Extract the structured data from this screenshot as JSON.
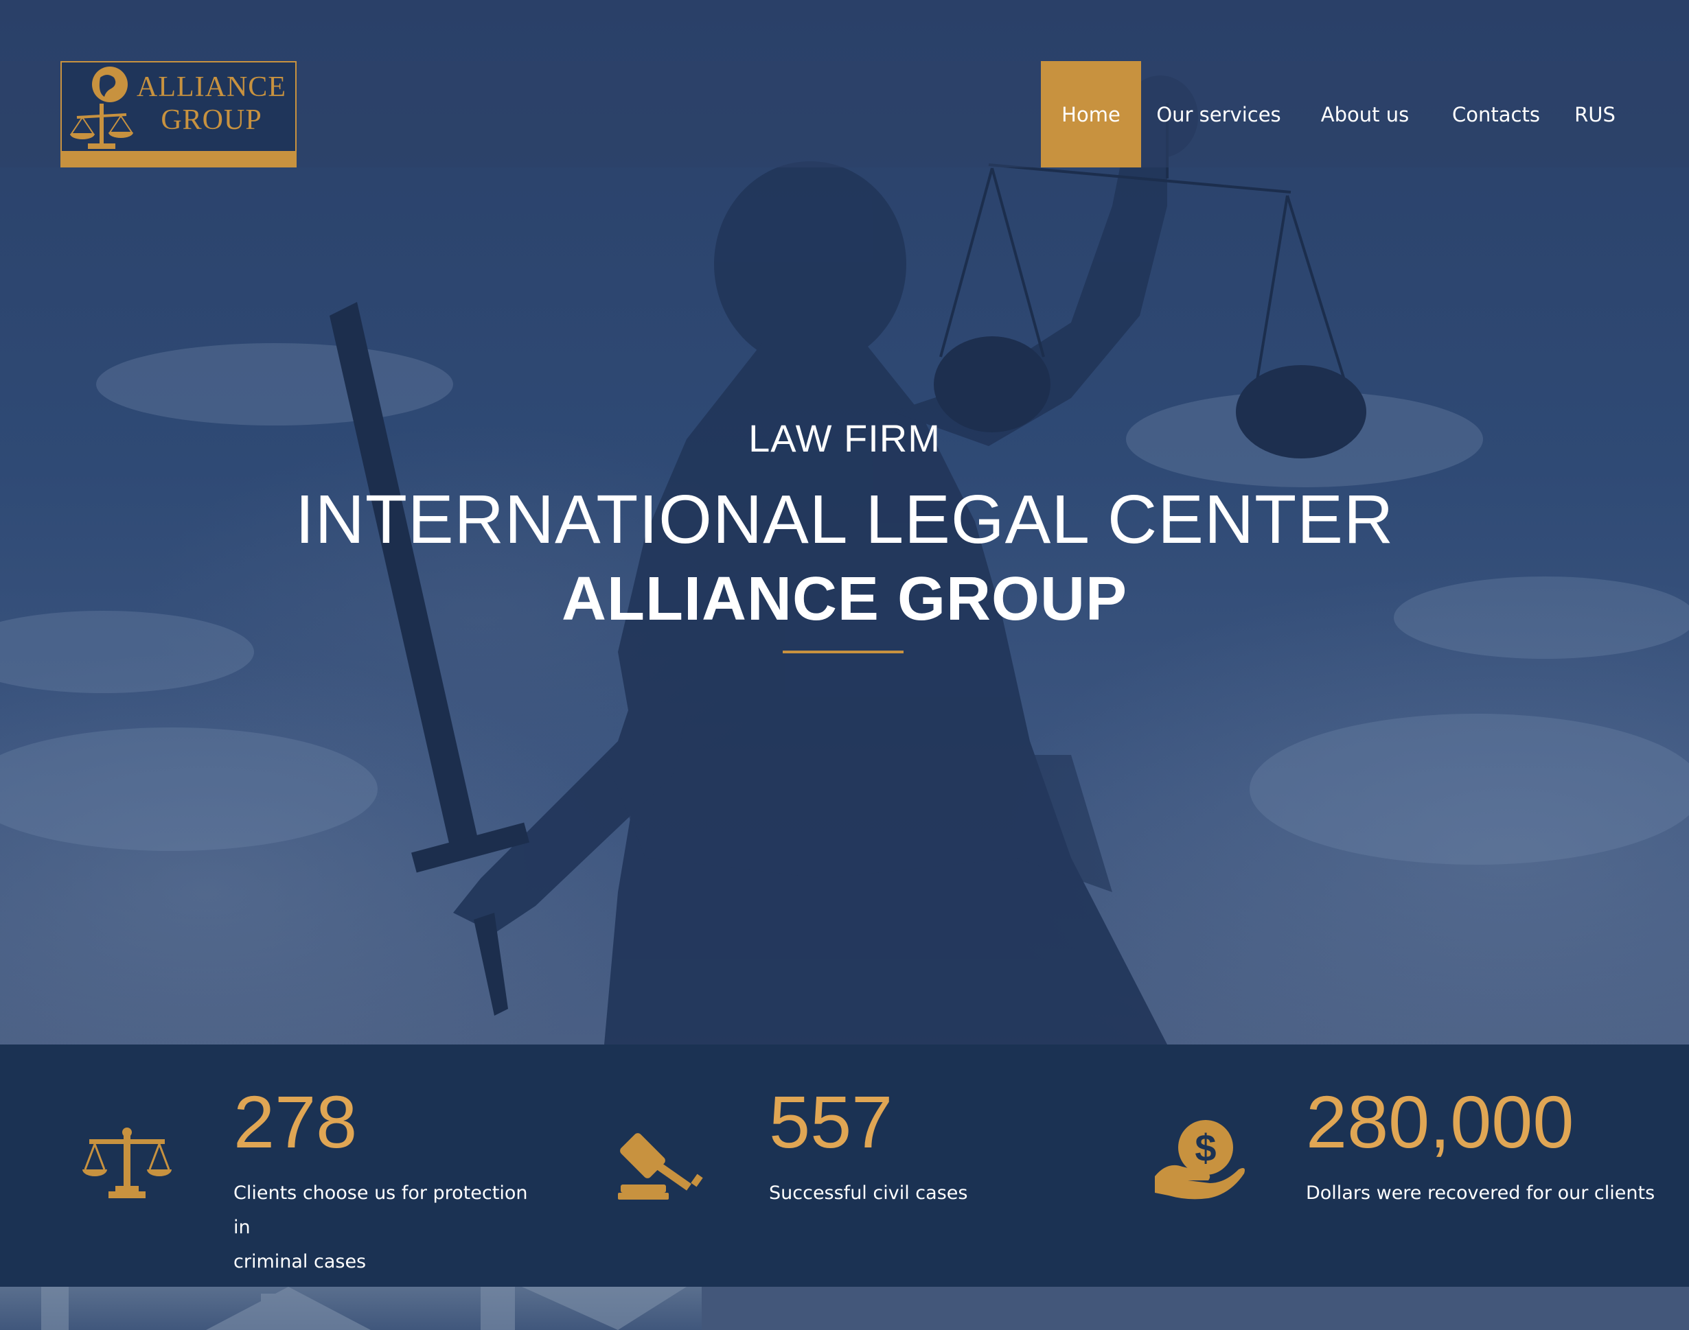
{
  "logo": {
    "line1": "ALLIANCE",
    "line2": "GROUP"
  },
  "nav": {
    "items": [
      {
        "label": "Home",
        "active": true
      },
      {
        "label": "Our services",
        "active": false
      },
      {
        "label": "About us",
        "active": false
      },
      {
        "label": "Contacts",
        "active": false
      },
      {
        "label": "RUS",
        "active": false
      }
    ]
  },
  "hero": {
    "kicker": "LAW FIRM",
    "title": "INTERNATIONAL LEGAL CENTER",
    "subtitle": "ALLIANCE GROUP"
  },
  "stats": [
    {
      "icon": "scales-icon",
      "number": "278",
      "text_line1": "Clients choose us for protection in",
      "text_line2": "criminal cases"
    },
    {
      "icon": "gavel-icon",
      "number": "557",
      "text_line1": "Successful civil cases",
      "text_line2": ""
    },
    {
      "icon": "money-hand-icon",
      "number": "280,000",
      "text_line1": "Dollars were recovered for our clients",
      "text_line2": ""
    }
  ],
  "colors": {
    "accent": "#c8923f",
    "stat_number": "#e0a654",
    "navy": "#1b3253"
  }
}
